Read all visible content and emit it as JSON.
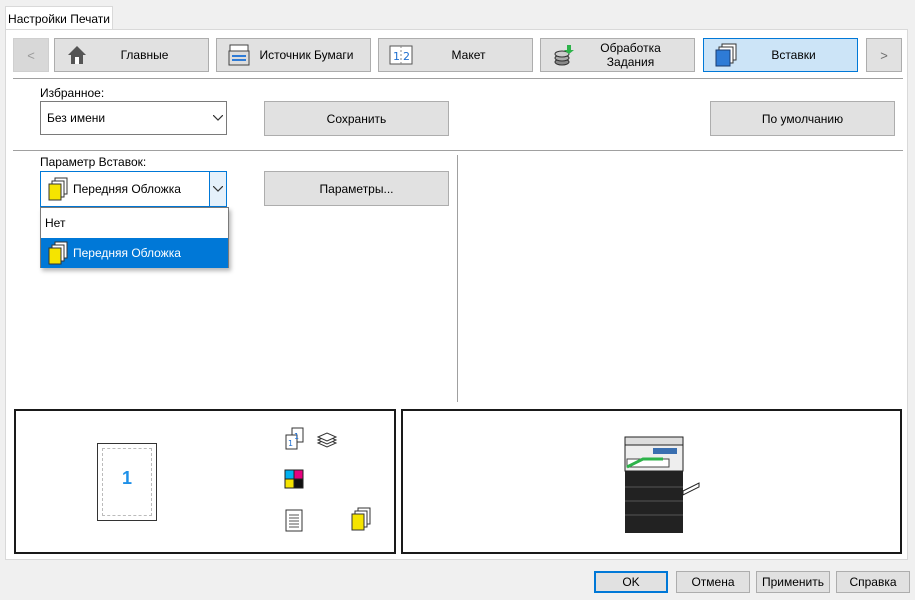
{
  "dialog_tab": "Настройки Печати",
  "nav": {
    "prev": "<",
    "next": ">",
    "tabs": [
      {
        "label": "Главные",
        "icon": "home-icon"
      },
      {
        "label": "Источник Бумаги",
        "icon": "paper-source-icon"
      },
      {
        "label": "Макет",
        "icon": "layout-icon"
      },
      {
        "label": "Обработка Задания",
        "icon": "job-handling-icon"
      },
      {
        "label": "Вставки",
        "icon": "inserts-icon",
        "selected": true
      }
    ]
  },
  "favorites": {
    "label": "Избранное:",
    "value": "Без имени",
    "save": "Сохранить",
    "defaults": "По умолчанию"
  },
  "inserts": {
    "label": "Параметр Вставок:",
    "value": "Передняя Обложка",
    "params_button": "Параметры...",
    "options": [
      "Нет",
      "Передняя Обложка"
    ],
    "highlighted_option": "Передняя Обложка"
  },
  "preview": {
    "page_number": "1"
  },
  "footer": {
    "ok": "OK",
    "cancel": "Отмена",
    "apply": "Применить",
    "help": "Справка"
  },
  "colors": {
    "accent": "#0078d7",
    "selected_tab": "#cce4f7",
    "page_number": "#1e90e8"
  }
}
